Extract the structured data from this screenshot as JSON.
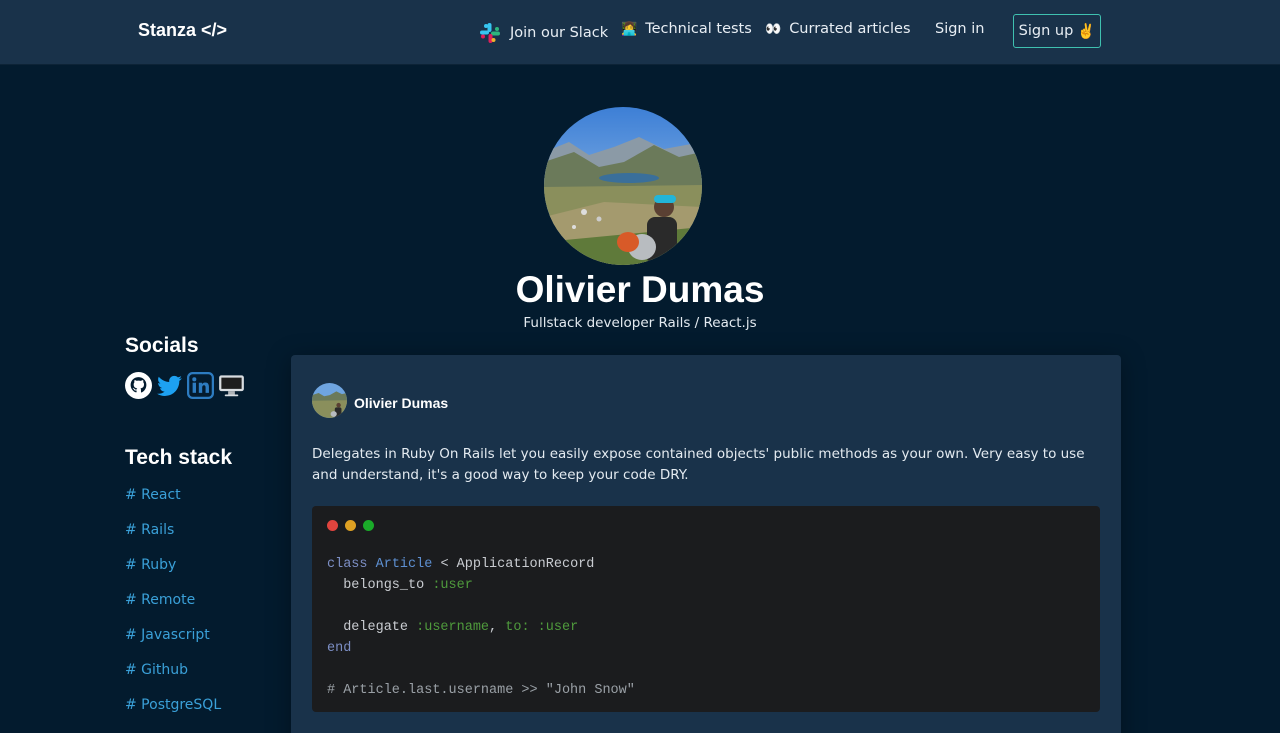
{
  "nav": {
    "brand": "Stanza </>",
    "links": [
      {
        "label": "Join our Slack",
        "icon": "slack-icon"
      },
      {
        "label": "Technical tests",
        "icon": "👩‍💻"
      },
      {
        "label": "Currated articles",
        "icon": "👀"
      }
    ],
    "signin": "Sign in",
    "signup": "Sign up",
    "signup_emoji": "✌️"
  },
  "profile": {
    "name": "Olivier Dumas",
    "role": "Fullstack developer Rails / React.js"
  },
  "sidebar": {
    "socials_title": "Socials",
    "socials": [
      "github-icon",
      "twitter-icon",
      "linkedin-icon",
      "website-icon"
    ],
    "techstack_title": "Tech stack",
    "tags": [
      "# React",
      "# Rails",
      "# Ruby",
      "# Remote",
      "# Javascript",
      "# Github",
      "# PostgreSQL"
    ]
  },
  "post": {
    "author": "Olivier Dumas",
    "text": "Delegates in Ruby On Rails let you easily expose contained objects' public methods as your own. Very easy to use and understand, it's a good way to keep your code DRY.",
    "code": {
      "line1_kw": "class",
      "line1_cls": "Article",
      "line1_rest": " < ApplicationRecord",
      "line2_method": "  belongs_to ",
      "line2_sym": ":user",
      "line4_method": "  delegate ",
      "line4_sym1": ":username",
      "line4_comma": ", ",
      "line4_key": "to:",
      "line4_space": " ",
      "line4_sym2": ":user",
      "line5_kw": "end",
      "line7_comment": "# Article.last.username >> \"John Snow\""
    }
  },
  "colors": {
    "background": "#031b2e",
    "nav": "#19324a",
    "card": "#19324a",
    "accent": "#3fc1b0",
    "tag": "#3aa0d8"
  }
}
